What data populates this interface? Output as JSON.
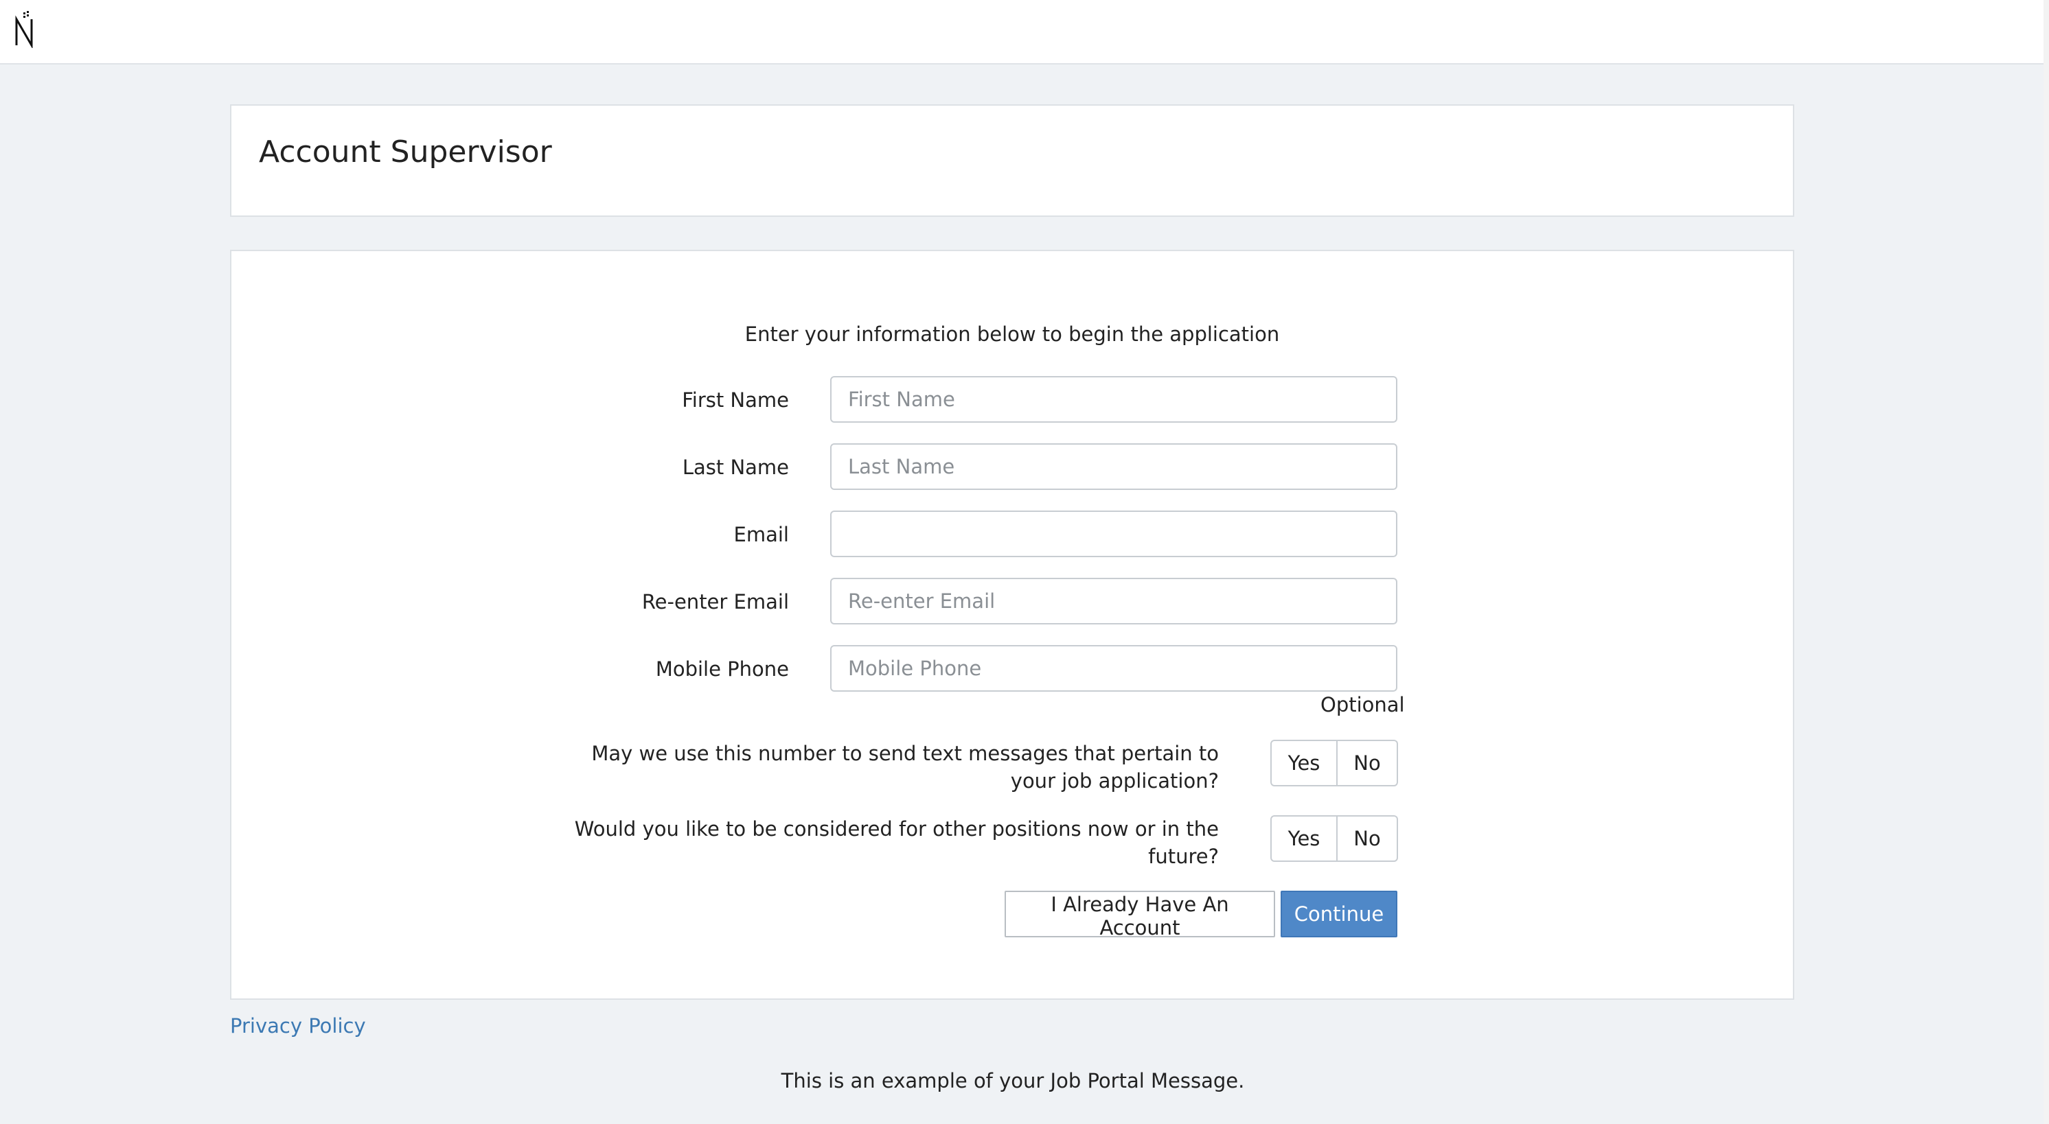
{
  "header": {
    "logo_icon": "n-logo-icon"
  },
  "title": "Account Supervisor",
  "form": {
    "intro": "Enter your information below to begin the application",
    "fields": [
      {
        "label": "First Name",
        "placeholder": "First Name",
        "value": ""
      },
      {
        "label": "Last Name",
        "placeholder": "Last Name",
        "value": ""
      },
      {
        "label": "Email",
        "placeholder": "",
        "value": ""
      },
      {
        "label": "Re-enter Email",
        "placeholder": "Re-enter Email",
        "value": ""
      },
      {
        "label": "Mobile Phone",
        "placeholder": "Mobile Phone",
        "value": ""
      }
    ],
    "optional_note": "Optional",
    "questions": [
      {
        "text": "May we use this number to send text messages that pertain to your job application?",
        "yes": "Yes",
        "no": "No"
      },
      {
        "text": "Would you like to be considered for other positions now or in the future?",
        "yes": "Yes",
        "no": "No"
      }
    ],
    "account_button": "I Already Have An Account",
    "continue_button": "Continue"
  },
  "footer": {
    "privacy_link": "Privacy Policy",
    "message": "This is an example of your Job Portal Message."
  },
  "colors": {
    "accent": "#4f88c8",
    "link": "#3c79b3",
    "background": "#eff2f5"
  }
}
